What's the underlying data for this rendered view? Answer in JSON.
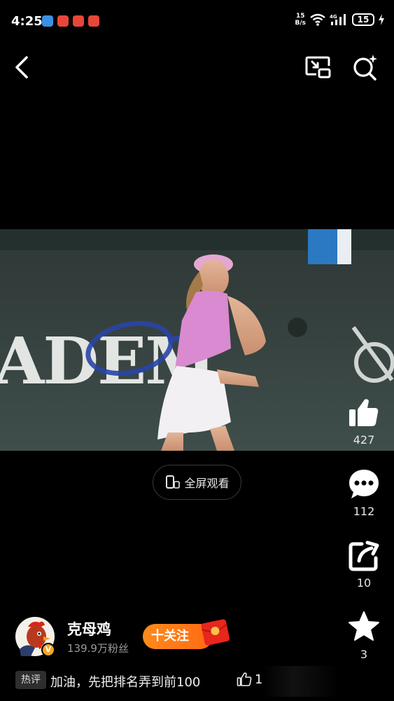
{
  "status_bar": {
    "time": "4:25",
    "net_speed_value": "15",
    "net_speed_unit": "B/s",
    "network": "4G",
    "battery": "15",
    "notification_colors": [
      "#3b8fe6",
      "#e8463a",
      "#e8463a",
      "#e8463a"
    ]
  },
  "nav": {
    "back_icon": "chevron-left-icon",
    "pip_icon": "picture-in-picture-icon",
    "search_icon": "search-sparkle-icon"
  },
  "video": {
    "banner_text": "ADEM"
  },
  "fullscreen": {
    "label": "全屏观看"
  },
  "actions": {
    "like": {
      "icon": "thumbs-up-icon",
      "count": "427"
    },
    "comment": {
      "icon": "comment-dots-icon",
      "count": "112"
    },
    "share": {
      "icon": "share-icon",
      "count": "10"
    },
    "favorite": {
      "icon": "star-icon",
      "count": "3"
    }
  },
  "author": {
    "name": "克母鸡",
    "fans": "139.9万粉丝",
    "verified_badge": "V",
    "follow_label": "十关注"
  },
  "hot_comment": {
    "tag": "热评",
    "text": "加油，先把排名弄到前100",
    "like_count": "1"
  },
  "colors": {
    "accent_orange": "#ff7a18",
    "background": "#000000"
  }
}
